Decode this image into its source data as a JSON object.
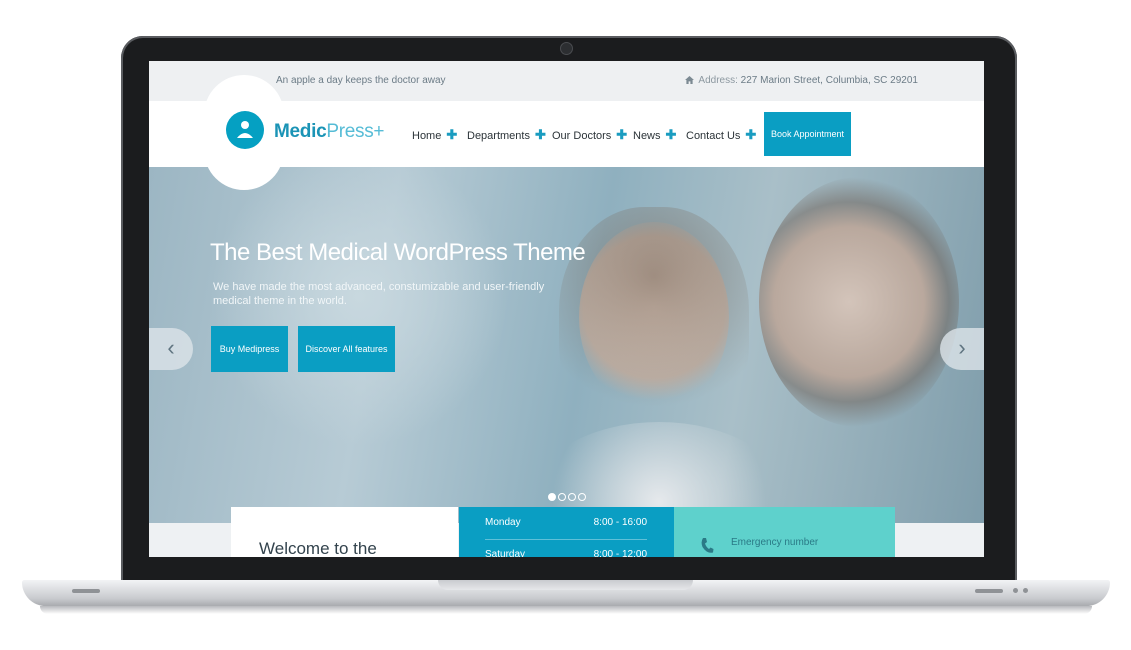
{
  "topbar": {
    "tagline": "An apple a day keeps the doctor away",
    "address_label": "Address:",
    "address_value": "227 Marion Street, Columbia, SC 29201"
  },
  "logo": {
    "main": "Medic",
    "accent": "Press+"
  },
  "nav": {
    "items": [
      {
        "label": "Home",
        "plus": "✚"
      },
      {
        "label": "Departments",
        "plus": "✚"
      },
      {
        "label": "Our Doctors",
        "plus": "✚"
      },
      {
        "label": "News",
        "plus": "✚"
      },
      {
        "label": "Contact Us",
        "plus": "✚"
      }
    ],
    "book_label": "Book Appointment"
  },
  "hero": {
    "title": "The Best Medical WordPress Theme",
    "subtitle": "We have made the most advanced, constumizable and user-friendly medical theme in the world.",
    "buy_label": "Buy Medipress",
    "discover_label": "Discover All features",
    "prev_arrow": "‹",
    "next_arrow": "›",
    "slides_total": 4,
    "slide_active": 1
  },
  "welcome": {
    "title": "Welcome to the"
  },
  "hours": [
    {
      "day": "Monday",
      "time": "8:00 - 16:00"
    },
    {
      "day": "Saturday",
      "time": "8:00 - 12:00"
    }
  ],
  "emergency": {
    "label": "Emergency number"
  },
  "colors": {
    "brand": "#0a9ec3",
    "teal": "#5ed1cc",
    "text": "#2b3338"
  }
}
